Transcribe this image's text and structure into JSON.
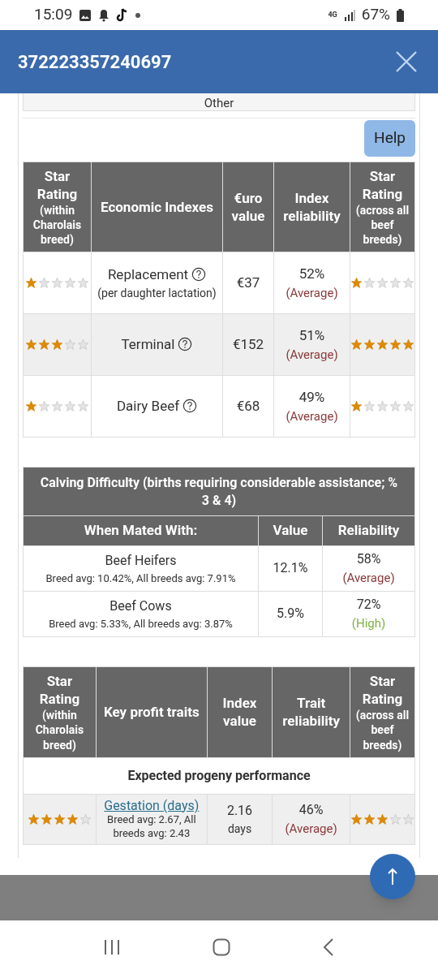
{
  "status_bar": {
    "time": "15:09",
    "network": "4G",
    "battery": "67%"
  },
  "header": {
    "title": "372223357240697"
  },
  "other_section": {
    "label": "Other"
  },
  "help_button": {
    "label": "Help"
  },
  "economic_table": {
    "columns": [
      {
        "title": "Star Rating",
        "subtitle": "(within Charolais breed)"
      },
      {
        "title": "Economic Indexes"
      },
      {
        "title": "€uro value"
      },
      {
        "title": "Index reliability"
      },
      {
        "title": "Star Rating",
        "subtitle": "(across all beef breeds)"
      }
    ],
    "rows": [
      {
        "within": {
          "stars": 1
        },
        "name": "Replacement",
        "note": "(per daughter lactation)",
        "value": "€37",
        "reliability": {
          "value": "52%",
          "label": "(Average)",
          "color": "#8b3a3a"
        },
        "across": {
          "stars": 1
        }
      },
      {
        "within": {
          "stars": 3
        },
        "name": "Terminal",
        "value": "€152",
        "reliability": {
          "value": "51%",
          "label": "(Average)",
          "color": "#8b3a3a"
        },
        "across": {
          "stars": 5
        }
      },
      {
        "within": {
          "stars": 1
        },
        "name": "Dairy Beef",
        "value": "€68",
        "reliability": {
          "value": "49%",
          "label": "(Average)",
          "color": "#8b3a3a"
        },
        "across": {
          "stars": 1
        }
      }
    ]
  },
  "calving_table": {
    "title": "Calving Difficulty (births requiring considerable assistance; % 3 & 4)",
    "columns": [
      "When Mated With:",
      "Value",
      "Reliability"
    ],
    "rows": [
      {
        "name": "Beef Heifers",
        "note": "Breed avg: 10.42%, All breeds avg: 7.91%",
        "value": "12.1%",
        "reliability": {
          "value": "58%",
          "label": "(Average)",
          "color": "#8b3a3a"
        }
      },
      {
        "name": "Beef Cows",
        "note": "Breed avg: 5.33%, All breeds avg: 3.87%",
        "value": "5.9%",
        "reliability": {
          "value": "72%",
          "label": "(High)",
          "color": "#7cb342"
        }
      }
    ]
  },
  "traits_table": {
    "columns": [
      {
        "title": "Star Rating",
        "subtitle": "(within Charolais breed)"
      },
      {
        "title": "Key profit traits"
      },
      {
        "title": "Index value"
      },
      {
        "title": "Trait reliability"
      },
      {
        "title": "Star Rating",
        "subtitle": "(across all beef breeds)"
      }
    ],
    "section": "Expected progeny performance",
    "rows": [
      {
        "within": {
          "stars": 4
        },
        "name": "Gestation (days)",
        "note": "Breed avg: 2.67, All breeds avg: 2.43",
        "value": "2.16",
        "unit": "days",
        "reliability": {
          "value": "46%",
          "label": "(Average)",
          "color": "#8b3a3a"
        },
        "across": {
          "stars": 3
        }
      }
    ]
  }
}
